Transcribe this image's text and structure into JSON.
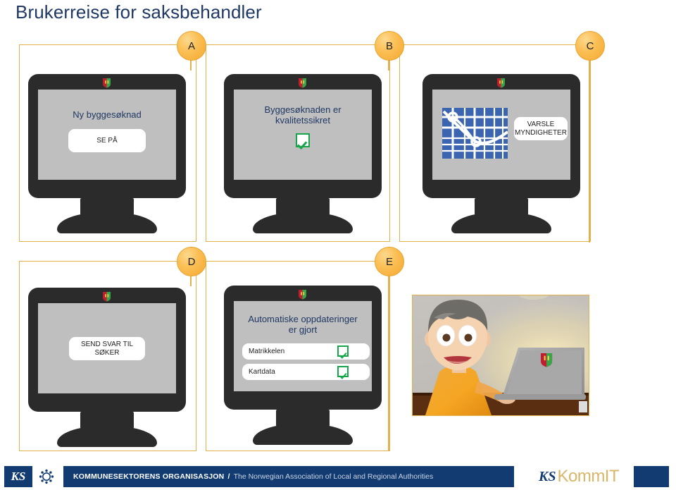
{
  "page": {
    "title": "Brukerreise for saksbehandler"
  },
  "steps": [
    {
      "badge": "A",
      "screen": {
        "heading": "Ny byggesøknad",
        "button": "SE PÅ"
      }
    },
    {
      "badge": "B",
      "screen": {
        "heading": "Byggesøknaden er kvalitetssikret",
        "check": "checkbox-checked-icon"
      }
    },
    {
      "badge": "C",
      "screen": {
        "map": "map-thumbnail",
        "button": "VARSLE MYNDIGHETER"
      }
    },
    {
      "badge": "D",
      "screen": {
        "button": "SEND SVAR TIL SØKER"
      }
    },
    {
      "badge": "E",
      "screen": {
        "heading": "Automatiske oppdateringer er gjort",
        "rows": [
          {
            "label": "Matrikkelen",
            "checked": true
          },
          {
            "label": "Kartdata",
            "checked": true
          }
        ]
      }
    }
  ],
  "illustration": {
    "name": "man-at-laptop-photo",
    "laptop_logo": "shield-logo"
  },
  "footer": {
    "ks_logo": "KS",
    "org_name": "KOMMUNESEKTORENS ORGANISASJON",
    "org_separator": "/",
    "org_name_en": "The Norwegian Association of Local and Regional Authorities",
    "kommit_ks": "KS",
    "kommit_name": "KommIT"
  },
  "colors": {
    "title_blue": "#1F3864",
    "accent_orange": "#E2B14C",
    "badge_orange": "#F4A82E",
    "screen_gray": "#BFBFBF",
    "bezel_dark": "#2B2B2B",
    "check_green": "#17A64A",
    "footer_blue": "#123B72",
    "map_blue": "#3B65B0"
  }
}
